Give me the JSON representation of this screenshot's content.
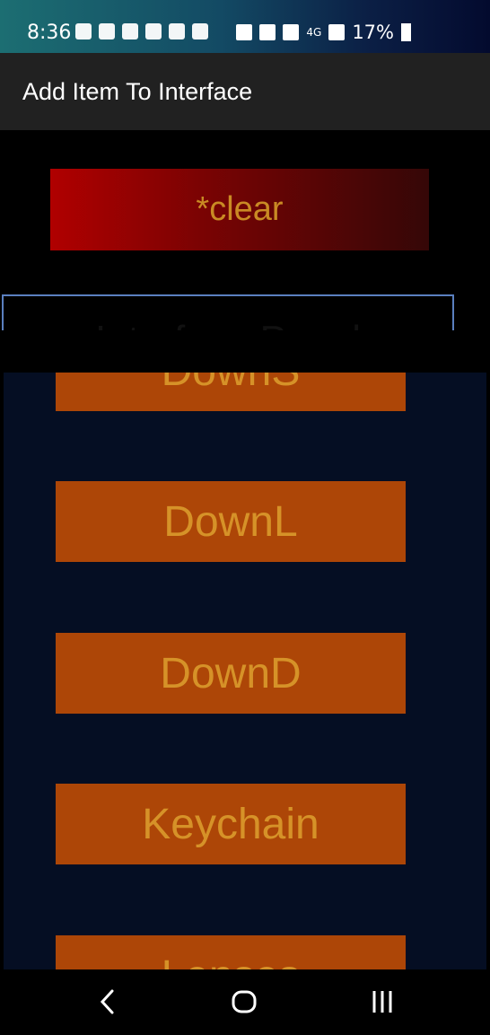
{
  "status_bar": {
    "time": "8:36",
    "battery": "17%",
    "network": "4G"
  },
  "app_bar": {
    "title": "Add Item To Interface"
  },
  "clear_button": {
    "label": "*clear"
  },
  "interface_select": {
    "label": "Interface Panel"
  },
  "list": {
    "items": [
      {
        "label": "DownS"
      },
      {
        "label": "DownL"
      },
      {
        "label": "DownD"
      },
      {
        "label": "Keychain"
      },
      {
        "label": "Lenses"
      }
    ]
  },
  "colors": {
    "item_bg": "#ad4607",
    "item_text": "#d69228",
    "list_bg": "#050e23",
    "appbar": "#212121"
  },
  "nav": {
    "back_icon": "back-icon",
    "home_icon": "home-icon",
    "recents_icon": "recents-icon"
  }
}
